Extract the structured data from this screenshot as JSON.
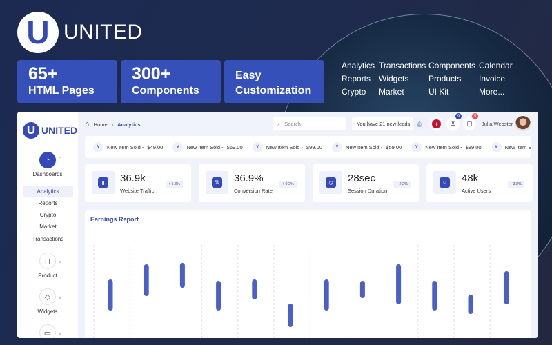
{
  "brand": {
    "letter": "U",
    "name": "UNITED"
  },
  "promo": [
    {
      "big": "65+",
      "small": "HTML Pages"
    },
    {
      "big": "300+",
      "small": "Components"
    },
    {
      "big": "Easy",
      "small": "Customization"
    }
  ],
  "feature_links": [
    "Analytics",
    "Transactions",
    "Components",
    "Calendar",
    "Reports",
    "Widgets",
    "Products",
    "Invoice",
    "Crypto",
    "Market",
    "UI Kit",
    "More..."
  ],
  "sidebar": {
    "brand": "UNITED",
    "sections": [
      {
        "label": "Dashboards",
        "icon": "gauge-icon"
      },
      {
        "label": "Product",
        "icon": "bag-icon"
      },
      {
        "label": "Widgets",
        "icon": "diamond-icon"
      },
      {
        "label": "",
        "icon": "briefcase-icon"
      }
    ],
    "items": [
      {
        "label": "Analytics",
        "active": true
      },
      {
        "label": "Reports"
      },
      {
        "label": "Crypto"
      },
      {
        "label": "Market"
      },
      {
        "label": "Transactions"
      }
    ]
  },
  "header": {
    "breadcrumb": [
      "Home",
      "Analytics"
    ],
    "search_placeholder": "Search",
    "leads": "You have 21 new leads",
    "cart_badge": "9",
    "message_badge": "5",
    "user": "Julia Webster",
    "accent": "#3549b7"
  },
  "ticker": [
    {
      "label": "New Item Sold - ",
      "price": "$49.00"
    },
    {
      "label": "New Item Sold - ",
      "price": "$69.00"
    },
    {
      "label": "New Item Sold - ",
      "price": "$99.00"
    },
    {
      "label": "New Item Sold - ",
      "price": "$59.00"
    },
    {
      "label": "New Item Sold - ",
      "price": "$89.00"
    },
    {
      "label": "New Item Sold - ",
      "price": "$"
    }
  ],
  "stats": [
    {
      "value": "36.9k",
      "label": "Website Traffic",
      "delta": "+ 6.8%",
      "icon": "chart-icon"
    },
    {
      "value": "36.9%",
      "label": "Conversion Rate",
      "delta": "+ 9.2%",
      "icon": "percent-icon"
    },
    {
      "value": "28sec",
      "label": "Session Duration",
      "delta": "+ 2.2%",
      "icon": "clock-icon"
    },
    {
      "value": "48k",
      "label": "Active Users",
      "delta": "- 3.8%",
      "icon": "users-icon"
    }
  ],
  "chart_data": {
    "type": "bar",
    "title": "Earnings Report",
    "style": "floating range bars",
    "color": "#4a5fc9",
    "ranges": [
      [
        40,
        85
      ],
      [
        61,
        107
      ],
      [
        73,
        109
      ],
      [
        40,
        83
      ],
      [
        56,
        85
      ],
      [
        16,
        50
      ],
      [
        40,
        85
      ],
      [
        58,
        83
      ],
      [
        49,
        107
      ],
      [
        40,
        83
      ],
      [
        35,
        63
      ],
      [
        49,
        97
      ]
    ]
  }
}
